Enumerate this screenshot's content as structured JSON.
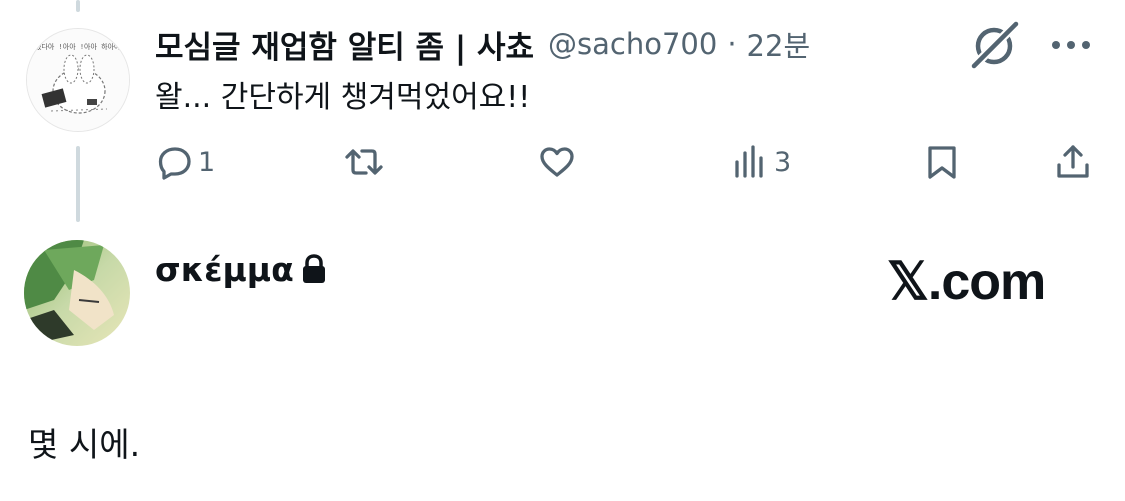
{
  "tweet1": {
    "display_name": "모심글 재업함 알티 좀 | 사쵸",
    "handle": "@sacho700",
    "separator": "·",
    "time": "22분",
    "text": "왈... 간단하게 챙겨먹었어요!!",
    "avatar_text": "했다아 !아아 !아아 하아아"
  },
  "actions": {
    "reply_count": "1",
    "view_count": "3"
  },
  "reply": {
    "display_name": "σκέμμα",
    "text": "몇 시에.",
    "brand": "𝕏.com"
  },
  "icons": [
    "grok-icon",
    "more-icon",
    "reply-icon",
    "retweet-icon",
    "like-icon",
    "views-icon",
    "bookmark-icon",
    "share-icon",
    "lock-icon"
  ]
}
